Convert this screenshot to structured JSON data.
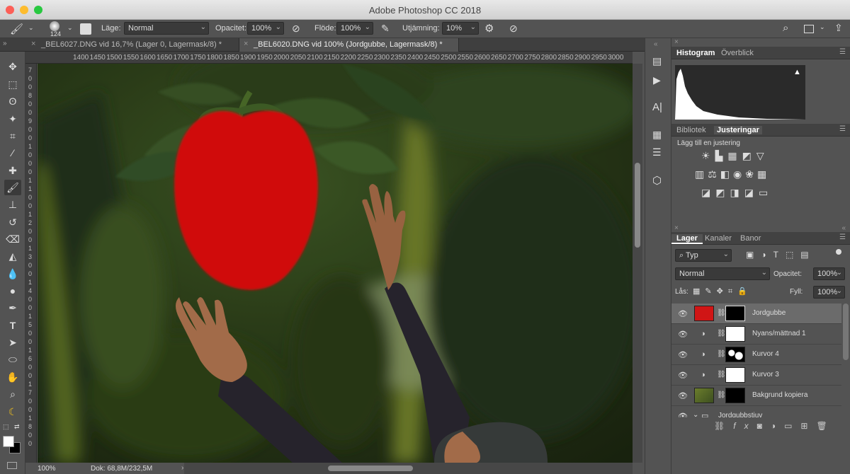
{
  "window": {
    "title": "Adobe Photoshop CC 2018"
  },
  "options_bar": {
    "brush_size": "124",
    "mode_label": "Läge:",
    "mode_value": "Normal",
    "opacity_label": "Opacitet:",
    "opacity_value": "100%",
    "flow_label": "Flöde:",
    "flow_value": "100%",
    "smoothing_label": "Utjämning:",
    "smoothing_value": "10%"
  },
  "doc_tabs": [
    {
      "label": "_BEL6027.DNG vid 16,7% (Lager 0, Lagermask/8) *",
      "active": false
    },
    {
      "label": "_BEL6020.DNG vid 100% (Jordgubbe, Lagermask/8) *",
      "active": true
    }
  ],
  "ruler_top": [
    "1400",
    "1450",
    "1500",
    "1550",
    "1600",
    "1650",
    "1700",
    "1750",
    "1800",
    "1850",
    "1900",
    "1950",
    "2000",
    "2050",
    "2100",
    "2150",
    "2200",
    "2250",
    "2300",
    "2350",
    "2400",
    "2450",
    "2500",
    "2550",
    "2600",
    "2650",
    "2700",
    "2750",
    "2800",
    "2850",
    "2900",
    "2950",
    "3000"
  ],
  "ruler_left": [
    "7",
    "0",
    "0",
    "8",
    "0",
    "0",
    "9",
    "0",
    "0",
    "1",
    "0",
    "0",
    "0",
    "1",
    "1",
    "0",
    "0",
    "1",
    "2",
    "0",
    "0",
    "1",
    "3",
    "0",
    "0",
    "1",
    "4",
    "0",
    "0",
    "1",
    "5",
    "0",
    "0",
    "1",
    "6",
    "0",
    "0",
    "1",
    "7",
    "0",
    "0",
    "1",
    "8",
    "0",
    "0"
  ],
  "status": {
    "zoom": "100%",
    "doc": "Dok: 68,8M/232,5M"
  },
  "histogram_panel": {
    "tabs": [
      "Histogram",
      "Överblick"
    ]
  },
  "adjust_panel": {
    "tabs": [
      "Bibliotek",
      "Justeringar"
    ],
    "heading": "Lägg till en justering"
  },
  "layers_panel": {
    "tabs": [
      "Lager",
      "Kanaler",
      "Banor"
    ],
    "filter_value": "Typ",
    "blend_value": "Normal",
    "opacity_label": "Opacitet:",
    "opacity_value": "100%",
    "lock_label": "Lås:",
    "fill_label": "Fyll:",
    "fill_value": "100%",
    "layers": [
      {
        "name": "Jordgubbe",
        "selected": true
      },
      {
        "name": "Nyans/mättnad 1",
        "selected": false
      },
      {
        "name": "Kurvor 4",
        "selected": false
      },
      {
        "name": "Kurvor 3",
        "selected": false
      },
      {
        "name": "Bakgrund kopiera",
        "selected": false
      },
      {
        "name": "Jordgubbstjuv",
        "selected": false
      }
    ]
  },
  "colors": {
    "strawberry": "#e21010",
    "ui_bg": "#535353"
  }
}
